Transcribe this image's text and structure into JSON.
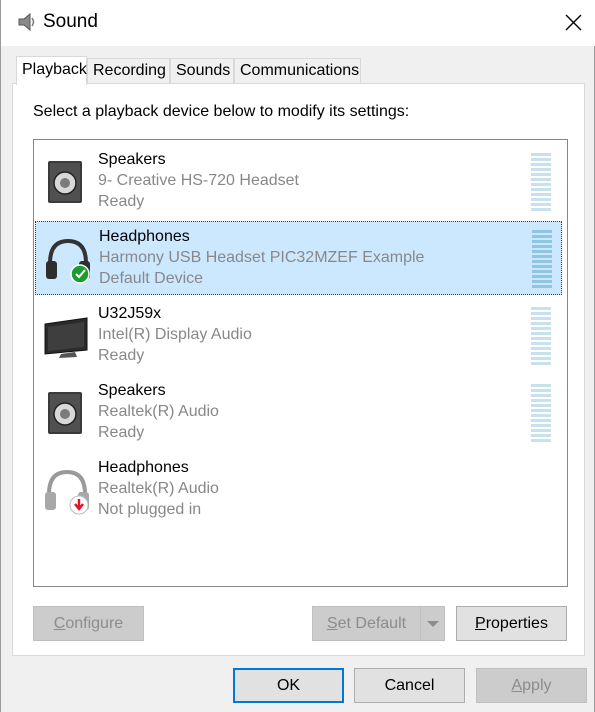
{
  "window": {
    "title": "Sound"
  },
  "tabs": [
    {
      "label": "Playback",
      "active": true
    },
    {
      "label": "Recording",
      "active": false
    },
    {
      "label": "Sounds",
      "active": false
    },
    {
      "label": "Communications",
      "active": false
    }
  ],
  "playback": {
    "instruction": "Select a playback device below to modify its settings:",
    "devices": [
      {
        "name": "Speakers",
        "description": "9- Creative HS-720 Headset",
        "status": "Ready",
        "icon": "speaker-icon",
        "selected": false,
        "meter": true
      },
      {
        "name": "Headphones",
        "description": "Harmony USB Headset PIC32MZEF Example",
        "status": "Default Device",
        "icon": "headphones-default-icon",
        "selected": true,
        "meter": true
      },
      {
        "name": "U32J59x",
        "description": "Intel(R) Display Audio",
        "status": "Ready",
        "icon": "monitor-icon",
        "selected": false,
        "meter": true
      },
      {
        "name": "Speakers",
        "description": "Realtek(R) Audio",
        "status": "Ready",
        "icon": "speaker-icon",
        "selected": false,
        "meter": true
      },
      {
        "name": "Headphones",
        "description": "Realtek(R) Audio",
        "status": "Not plugged in",
        "icon": "headphones-unplugged-icon",
        "selected": false,
        "meter": false
      }
    ],
    "buttons": {
      "configure": {
        "accel": "C",
        "rest": "onfigure",
        "enabled": false
      },
      "set_default": {
        "accel": "S",
        "rest": "et Default",
        "enabled": false
      },
      "properties": {
        "accel": "P",
        "rest": "roperties",
        "enabled": true
      }
    }
  },
  "dialog_buttons": {
    "ok": "OK",
    "cancel": "Cancel",
    "apply": {
      "accel": "A",
      "rest": "pply",
      "enabled": false
    }
  },
  "colors": {
    "selection": "#cce8ff",
    "default_check": "#1c9b2f",
    "unplugged_arrow": "#e81123",
    "focus_border": "#0078d7"
  }
}
